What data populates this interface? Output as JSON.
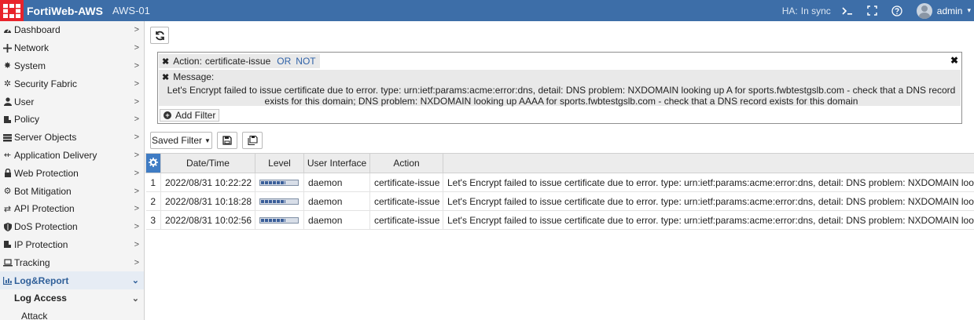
{
  "header": {
    "product": "FortiWeb-AWS",
    "hostname": "AWS-01",
    "ha_label": "HA:",
    "ha_status": "In sync",
    "user": "admin",
    "colors": {
      "bar": "#3d6ea8",
      "logo": "#e8232b"
    }
  },
  "sidebar": {
    "items": [
      {
        "label": "Dashboard",
        "icon": "dashboard-icon"
      },
      {
        "label": "Network",
        "icon": "network-icon"
      },
      {
        "label": "System",
        "icon": "gear-icon"
      },
      {
        "label": "Security Fabric",
        "icon": "security-fabric-icon"
      },
      {
        "label": "User",
        "icon": "user-icon"
      },
      {
        "label": "Policy",
        "icon": "policy-icon"
      },
      {
        "label": "Server Objects",
        "icon": "server-icon"
      },
      {
        "label": "Application Delivery",
        "icon": "delivery-icon"
      },
      {
        "label": "Web Protection",
        "icon": "lock-icon"
      },
      {
        "label": "Bot Mitigation",
        "icon": "bot-icon"
      },
      {
        "label": "API Protection",
        "icon": "api-icon"
      },
      {
        "label": "DoS Protection",
        "icon": "shield-icon"
      },
      {
        "label": "IP Protection",
        "icon": "ip-icon"
      },
      {
        "label": "Tracking",
        "icon": "laptop-icon"
      },
      {
        "label": "Log&Report",
        "icon": "chart-icon"
      }
    ],
    "sub_item": "Log Access",
    "subsub_item": "Attack",
    "chevron_right": ">",
    "chevron_down": "⌄"
  },
  "filter": {
    "action_label": "Action:",
    "action_value": "certificate-issue",
    "or_label": "OR",
    "not_label": "NOT",
    "message_label": "Message:",
    "message_text": "Let's Encrypt failed to issue certificate due to error. type: urn:ietf:params:acme:error:dns, detail: DNS problem: NXDOMAIN looking up A for sports.fwbtestgslb.com - check that a DNS record exists for this domain; DNS problem: NXDOMAIN looking up AAAA for sports.fwbtestgslb.com - check that a DNS record exists for this domain",
    "add_filter_label": "Add Filter"
  },
  "toolbar": {
    "saved_filter_label": "Saved Filter"
  },
  "table": {
    "columns": [
      "Date/Time",
      "Level",
      "User Interface",
      "Action"
    ],
    "rows": [
      {
        "num": "1",
        "datetime": "2022/08/31 10:22:22",
        "level": 0.64,
        "ui": "daemon",
        "action": "certificate-issue",
        "message": "Let's Encrypt failed to issue certificate due to error. type: urn:ietf:params:acme:error:dns, detail: DNS problem: NXDOMAIN looking up A"
      },
      {
        "num": "2",
        "datetime": "2022/08/31 10:18:28",
        "level": 0.64,
        "ui": "daemon",
        "action": "certificate-issue",
        "message": "Let's Encrypt failed to issue certificate due to error. type: urn:ietf:params:acme:error:dns, detail: DNS problem: NXDOMAIN looking up A"
      },
      {
        "num": "3",
        "datetime": "2022/08/31 10:02:56",
        "level": 0.64,
        "ui": "daemon",
        "action": "certificate-issue",
        "message": "Let's Encrypt failed to issue certificate due to error. type: urn:ietf:params:acme:error:dns, detail: DNS problem: NXDOMAIN looking up A"
      }
    ]
  }
}
